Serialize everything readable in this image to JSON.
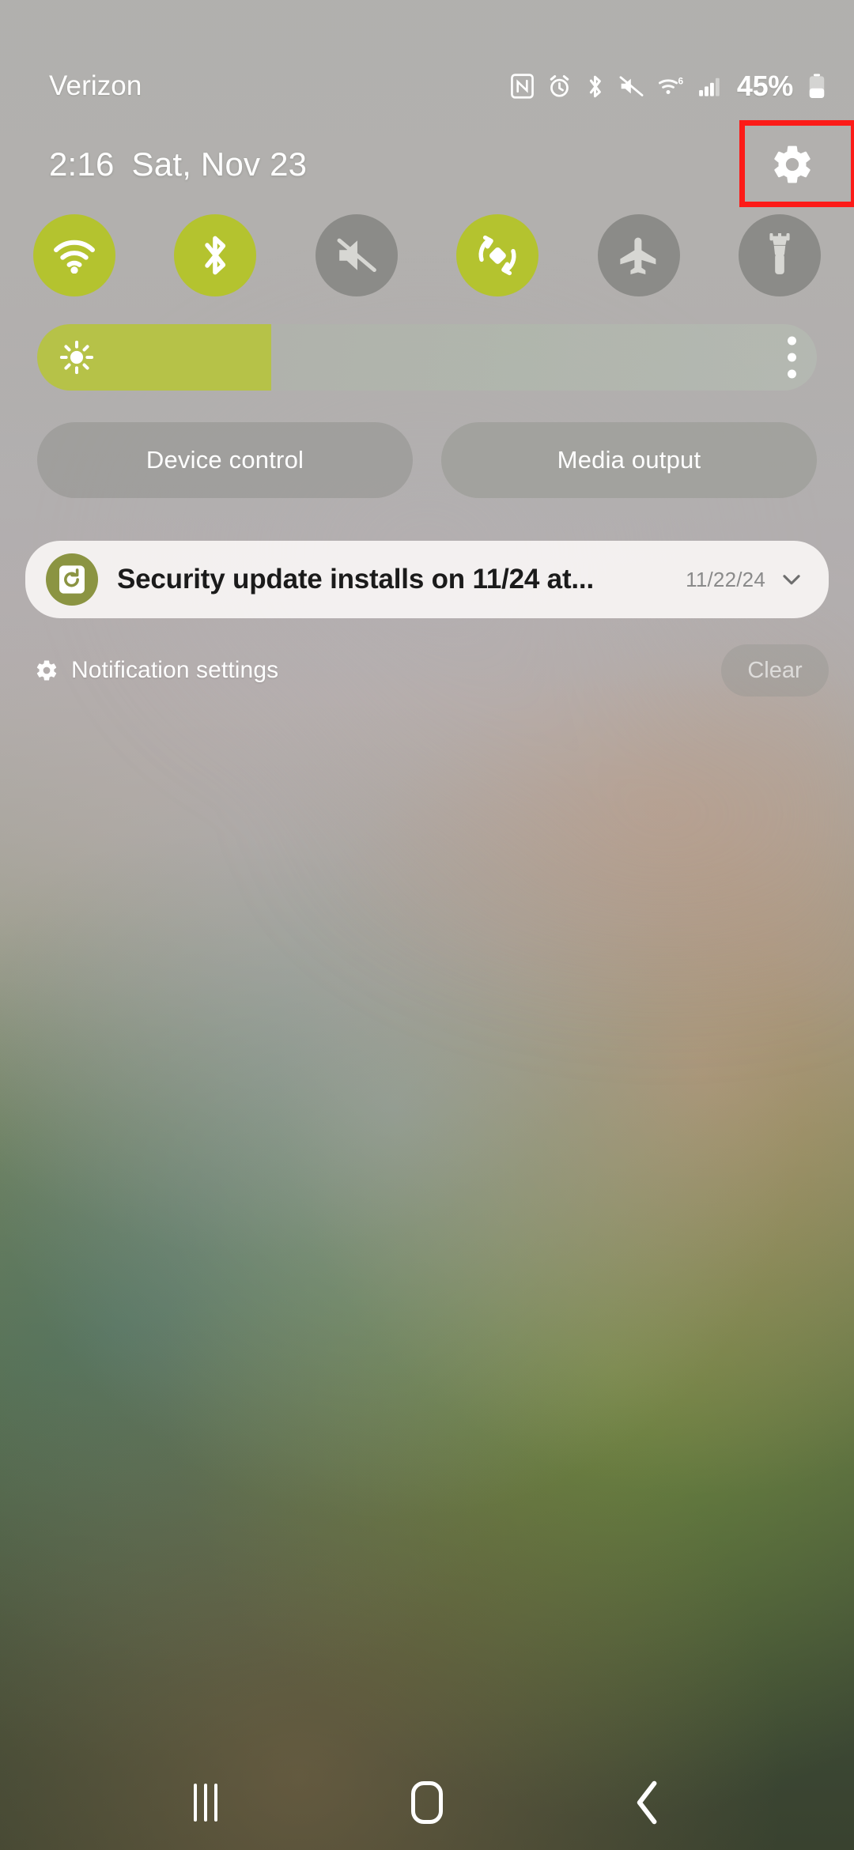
{
  "status_bar": {
    "carrier": "Verizon",
    "battery_percent": "45%",
    "wifi_generation": "6",
    "icons": [
      {
        "name": "nfc-icon",
        "label": "NFC"
      },
      {
        "name": "alarm-icon",
        "label": "Alarm set"
      },
      {
        "name": "bluetooth-icon",
        "label": "Bluetooth"
      },
      {
        "name": "mute-icon",
        "label": "Sound muted"
      },
      {
        "name": "wifi-icon",
        "label": "Wi-Fi 6"
      },
      {
        "name": "cellular-signal-icon",
        "label": "Cellular signal"
      },
      {
        "name": "battery-icon",
        "label": "Battery"
      }
    ]
  },
  "header": {
    "time": "2:16",
    "date": "Sat, Nov 23",
    "settings_icon": "gear-icon",
    "highlight_color": "#fc1b18"
  },
  "quick_toggles": {
    "on_color": "#b4c32f",
    "off_color": "#8b8b88",
    "items": [
      {
        "name": "wifi-toggle",
        "label": "Wi-Fi",
        "state": "on"
      },
      {
        "name": "bluetooth-toggle",
        "label": "Bluetooth",
        "state": "on"
      },
      {
        "name": "sound-mute-toggle",
        "label": "Mute",
        "state": "off"
      },
      {
        "name": "auto-rotate-toggle",
        "label": "Auto rotate",
        "state": "on"
      },
      {
        "name": "airplane-toggle",
        "label": "Airplane mode",
        "state": "off"
      },
      {
        "name": "flashlight-toggle",
        "label": "Flashlight",
        "state": "off"
      }
    ]
  },
  "brightness": {
    "value_percent": 30,
    "fill_color": "#b6c248",
    "icon": "brightness-sun-icon",
    "menu_icon": "overflow-menu-icon"
  },
  "actions": {
    "device_control_label": "Device control",
    "media_output_label": "Media output"
  },
  "notifications": {
    "items": [
      {
        "app_icon": "software-update-icon",
        "title": "Security update installs on 11/24 at...",
        "time": "11/22/24",
        "expand_icon": "chevron-down-icon"
      }
    ],
    "settings_label": "Notification settings",
    "settings_icon": "gear-icon",
    "clear_label": "Clear"
  },
  "nav_bar": {
    "recents_label": "Recents",
    "home_label": "Home",
    "back_label": "Back"
  }
}
